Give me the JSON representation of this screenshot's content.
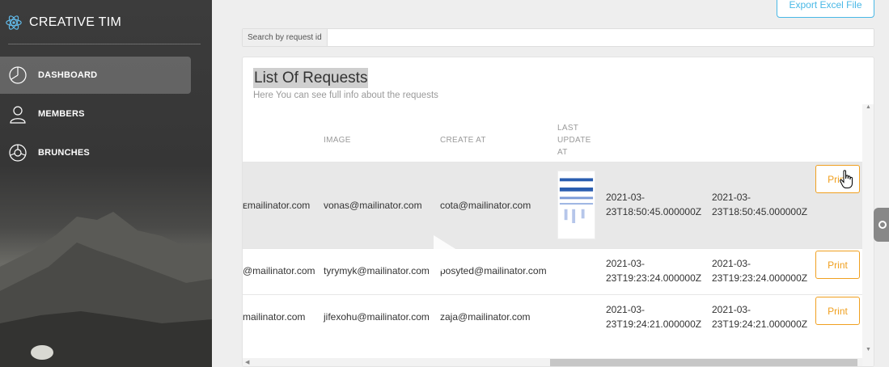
{
  "brand": {
    "name": "CREATIVE TIM",
    "logo_icon": "react-atom-icon"
  },
  "sidebar": {
    "items": [
      {
        "label": "DASHBOARD",
        "icon": "pie-chart-icon",
        "active": true
      },
      {
        "label": "MEMBERS",
        "icon": "user-icon",
        "active": false
      },
      {
        "label": "BRUNCHES",
        "icon": "globe-icon",
        "active": false
      }
    ]
  },
  "toolbar": {
    "export_label": "Export Excel File"
  },
  "search": {
    "label": "Search by request id",
    "value": ""
  },
  "card": {
    "title": "List Of Requests",
    "subtitle": "Here You can see full info about the requests"
  },
  "table": {
    "headers": {
      "image": "IMAGE",
      "create_at": "CREATE AT",
      "last_update_at": "LAST UPDATE AT"
    },
    "header_lines": {
      "l1": "LAST",
      "l2": "UPDATE",
      "l3": "AT"
    },
    "rows": [
      {
        "col1": "ᴇmailinator.com",
        "image": "vonas@mailinator.com",
        "create_at": "cota@mailinator.com",
        "created": [
          "2021-03-",
          "23T18:50:45.000000Z"
        ],
        "updated": [
          "2021-03-",
          "23T18:50:45.000000Z"
        ],
        "action": "Print"
      },
      {
        "col1": "@mailinator.com",
        "image": "tyrymyk@mailinator.com",
        "create_at": "posyted@mailinator.com",
        "created": [
          "2021-03-",
          "23T19:23:24.000000Z"
        ],
        "updated": [
          "2021-03-",
          "23T19:23:24.000000Z"
        ],
        "action": "Print"
      },
      {
        "col1": "mailinator.com",
        "image": "jifexohu@mailinator.com",
        "create_at": "zaja@mailinator.com",
        "created": [
          "2021-03-",
          "23T19:24:21.000000Z"
        ],
        "updated": [
          "2021-03-",
          "23T19:24:21.000000Z"
        ],
        "action": "Print"
      }
    ]
  },
  "colors": {
    "accent_blue": "#49b8e6",
    "print_orange": "#f0a020"
  }
}
